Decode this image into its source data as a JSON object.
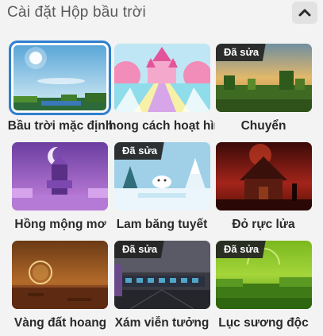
{
  "header": {
    "title": "Cài đặt Hộp bầu trời"
  },
  "skyboxes": [
    {
      "label": "Bầu trời mặc định",
      "badge": "",
      "selected": true
    },
    {
      "label": "hong cách hoạt hìn",
      "badge": "",
      "selected": false
    },
    {
      "label": "Chuyển",
      "badge": "Đã sửa",
      "selected": false
    },
    {
      "label": "Hồng mộng mơ",
      "badge": "",
      "selected": false
    },
    {
      "label": "Lam băng tuyết",
      "badge": "Đã sửa",
      "selected": false
    },
    {
      "label": "Đỏ rực lửa",
      "badge": "",
      "selected": false
    },
    {
      "label": "Vàng đất hoang",
      "badge": "",
      "selected": false
    },
    {
      "label": "Xám viễn tưởng",
      "badge": "Đã sửa",
      "selected": false
    },
    {
      "label": "Lục sương độc",
      "badge": "Đã sửa",
      "selected": false
    }
  ],
  "colors": {
    "selection_outline": "#2f7fd0",
    "badge_bg": "#232323"
  },
  "icons": {
    "collapse": "chevron-up-icon"
  }
}
